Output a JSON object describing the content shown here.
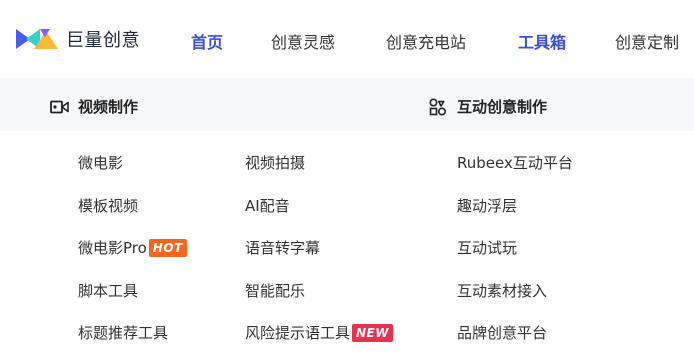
{
  "brand": {
    "name": "巨量创意"
  },
  "nav": {
    "items": [
      {
        "label": "首页",
        "active": true
      },
      {
        "label": "创意灵感",
        "active": false
      },
      {
        "label": "创意充电站",
        "active": false
      },
      {
        "label": "工具箱",
        "active": true
      },
      {
        "label": "创意定制",
        "active": false
      }
    ]
  },
  "sections": {
    "video": {
      "title": "视频制作",
      "icon": "video-camera-icon"
    },
    "interactive": {
      "title": "互动创意制作",
      "icon": "shapes-icon"
    }
  },
  "tools": {
    "col1": [
      "微电影",
      "模板视频",
      "微电影Pro",
      "脚本工具",
      "标题推荐工具"
    ],
    "col2": [
      "视频拍摄",
      "AI配音",
      "语音转字幕",
      "智能配乐",
      "风险提示语工具"
    ],
    "col3": [
      "Rubeex互动平台",
      "趣动浮层",
      "互动试玩",
      "互动素材接入",
      "品牌创意平台"
    ]
  },
  "badges": {
    "hot": {
      "label": "HOT",
      "color": "#f5671f"
    },
    "new": {
      "label": "NEW",
      "color": "#e8314f"
    }
  },
  "colors": {
    "accent": "#3b4cd6"
  }
}
